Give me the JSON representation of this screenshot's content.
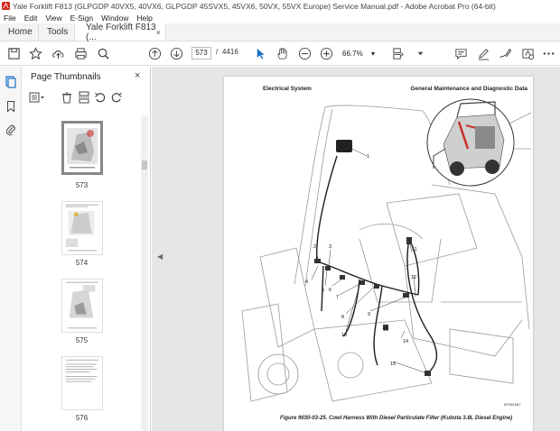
{
  "window": {
    "title": "Yale Forklift F813 (GLPGDP 40VX5, 40VX6, GLPGDP 45SVX5, 45VX6, 50VX, 55VX Europe) Service Manual.pdf - Adobe Acrobat Pro (64-bit)"
  },
  "menu": [
    "File",
    "Edit",
    "View",
    "E-Sign",
    "Window",
    "Help"
  ],
  "tabs": {
    "home": "Home",
    "tools": "Tools",
    "doc": "Yale Forklift F813 (...",
    "doc_close": "×"
  },
  "toolbar": {
    "page_current": "573",
    "page_sep": "/",
    "page_total": "4416",
    "zoom": "66.7%",
    "zoom_caret": "▾"
  },
  "panel": {
    "header": "Page Thumbnails",
    "close": "×",
    "thumbnails": [
      {
        "label": "573",
        "selected": true
      },
      {
        "label": "574",
        "selected": false
      },
      {
        "label": "575",
        "selected": false
      },
      {
        "label": "576",
        "selected": false
      }
    ]
  },
  "page": {
    "header_left": "Electrical System",
    "header_right": "General Maintenance and Diagnostic Data",
    "caption": "Figure 9030-03-25. Cowl Harness With Diesel Particulate Filter (Kubota 3.8L Diesel Engine)",
    "figure_code": "BT981567",
    "callouts": [
      "1",
      "2",
      "3",
      "4",
      "5",
      "6",
      "7",
      "8",
      "9",
      "10",
      "11",
      "12",
      "13",
      "14",
      "15"
    ]
  },
  "colors": {
    "accent_blue": "#1a73c9",
    "acrobat_red": "#d4271d",
    "harness_red": "#c8302a"
  }
}
